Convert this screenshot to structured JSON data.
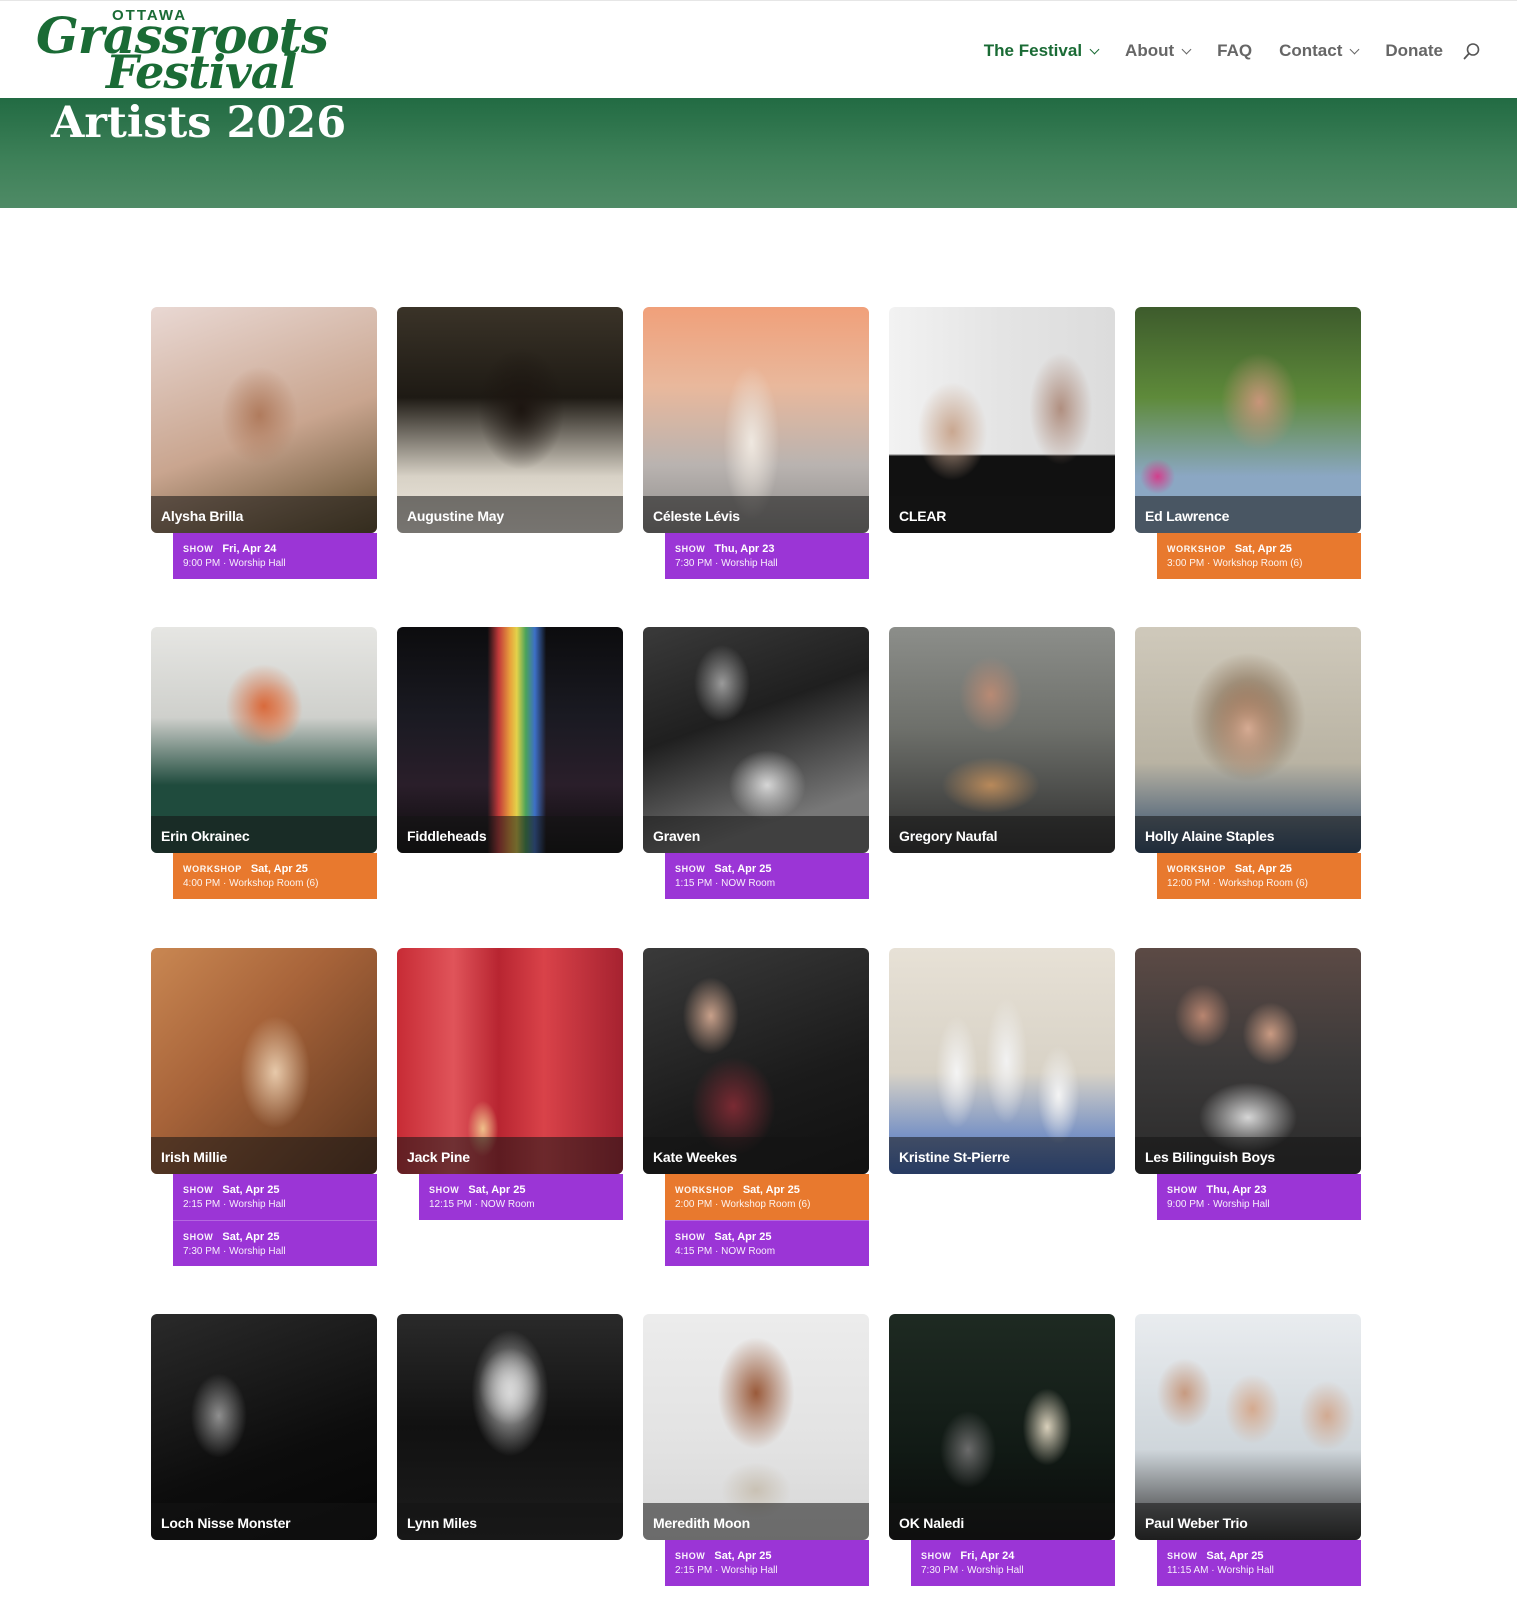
{
  "header": {
    "logo": {
      "top": "OTTAWA",
      "line1": "Grassroots",
      "line2": "Festival"
    },
    "nav": [
      {
        "label": "The Festival",
        "dropdown": true,
        "active": true
      },
      {
        "label": "About",
        "dropdown": true,
        "active": false
      },
      {
        "label": "FAQ",
        "dropdown": false,
        "active": false
      },
      {
        "label": "Contact",
        "dropdown": true,
        "active": false
      },
      {
        "label": "Donate",
        "dropdown": false,
        "active": false
      }
    ]
  },
  "page_title": "Artists 2026",
  "colors": {
    "brand_green": "#1a6b35",
    "show": "#9b35d6",
    "workshop": "#e8792e"
  },
  "artists": [
    {
      "name": "Alysha Brilla",
      "events": [
        {
          "type": "SHOW",
          "day": "Fri, Apr 24",
          "detail": "9:00 PM · Worship Hall"
        }
      ]
    },
    {
      "name": "Augustine May",
      "events": []
    },
    {
      "name": "Céleste Lévis",
      "events": [
        {
          "type": "SHOW",
          "day": "Thu, Apr 23",
          "detail": "7:30 PM · Worship Hall"
        }
      ]
    },
    {
      "name": "CLEAR",
      "events": []
    },
    {
      "name": "Ed Lawrence",
      "events": [
        {
          "type": "WORKSHOP",
          "day": "Sat, Apr 25",
          "detail": "3:00 PM · Workshop Room (6)"
        }
      ]
    },
    {
      "name": "Erin Okrainec",
      "events": [
        {
          "type": "WORKSHOP",
          "day": "Sat, Apr 25",
          "detail": "4:00 PM · Workshop Room (6)"
        }
      ]
    },
    {
      "name": "Fiddleheads",
      "events": []
    },
    {
      "name": "Graven",
      "events": [
        {
          "type": "SHOW",
          "day": "Sat, Apr 25",
          "detail": "1:15 PM · NOW Room"
        }
      ]
    },
    {
      "name": "Gregory Naufal",
      "events": []
    },
    {
      "name": "Holly Alaine Staples",
      "events": [
        {
          "type": "WORKSHOP",
          "day": "Sat, Apr 25",
          "detail": "12:00 PM · Workshop Room (6)"
        }
      ]
    },
    {
      "name": "Irish Millie",
      "events": [
        {
          "type": "SHOW",
          "day": "Sat, Apr 25",
          "detail": "2:15 PM · Worship Hall"
        },
        {
          "type": "SHOW",
          "day": "Sat, Apr 25",
          "detail": "7:30 PM · Worship Hall"
        }
      ]
    },
    {
      "name": "Jack Pine",
      "events": [
        {
          "type": "SHOW",
          "day": "Sat, Apr 25",
          "detail": "12:15 PM · NOW Room"
        }
      ]
    },
    {
      "name": "Kate Weekes",
      "events": [
        {
          "type": "WORKSHOP",
          "day": "Sat, Apr 25",
          "detail": "2:00 PM · Workshop Room (6)"
        },
        {
          "type": "SHOW",
          "day": "Sat, Apr 25",
          "detail": "4:15 PM · NOW Room"
        }
      ]
    },
    {
      "name": "Kristine St-Pierre",
      "events": []
    },
    {
      "name": "Les Bilinguish Boys",
      "events": [
        {
          "type": "SHOW",
          "day": "Thu, Apr 23",
          "detail": "9:00 PM · Worship Hall"
        }
      ]
    },
    {
      "name": "Loch Nisse Monster",
      "events": []
    },
    {
      "name": "Lynn Miles",
      "events": []
    },
    {
      "name": "Meredith Moon",
      "events": [
        {
          "type": "SHOW",
          "day": "Sat, Apr 25",
          "detail": "2:15 PM · Worship Hall"
        }
      ]
    },
    {
      "name": "OK Naledi",
      "events": [
        {
          "type": "SHOW",
          "day": "Fri, Apr 24",
          "detail": "7:30 PM · Worship Hall"
        }
      ]
    },
    {
      "name": "Paul Weber Trio",
      "events": [
        {
          "type": "SHOW",
          "day": "Sat, Apr 25",
          "detail": "11:15 AM · Worship Hall"
        }
      ]
    }
  ]
}
